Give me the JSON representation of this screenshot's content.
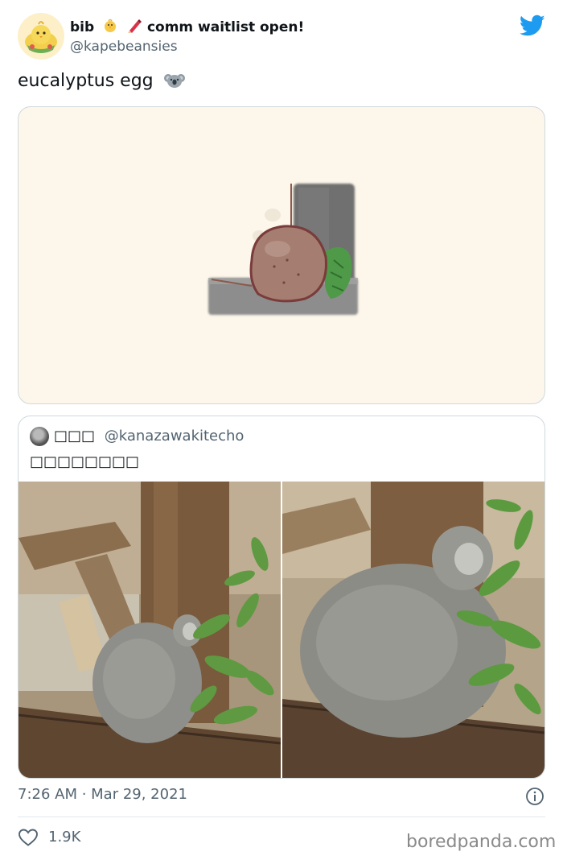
{
  "tweet": {
    "display_name": "bib",
    "display_name_suffix": "comm waitlist open!",
    "name_emojis": [
      "chick-emoji",
      "crayon-emoji"
    ],
    "handle": "@kapebeansies",
    "text": "eucalyptus egg",
    "text_emoji": "koala-emoji",
    "timestamp": "7:26 AM · Mar 29, 2021",
    "likes": "1.9K"
  },
  "quoted": {
    "name": "□□□",
    "handle": "@kanazawakitecho",
    "text": "□□□□□□□□"
  },
  "watermark": "boredpanda.com",
  "icons": {
    "brand": "twitter-bird-icon",
    "info": "info-icon",
    "like": "heart-icon"
  },
  "colors": {
    "twitter_blue": "#1d9bf0",
    "secondary_text": "#536471",
    "card_border": "#cfd9de",
    "art_background": "#fdf6ea"
  }
}
